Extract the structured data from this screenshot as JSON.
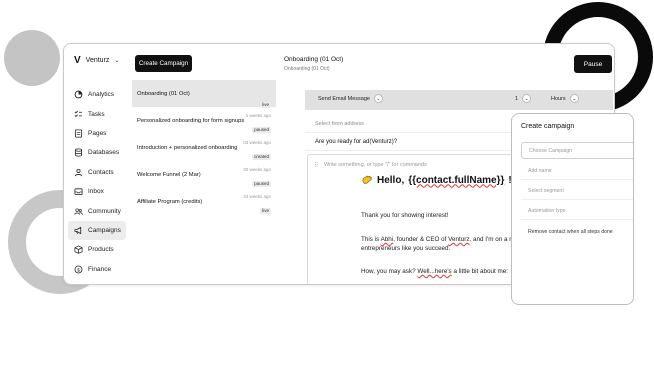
{
  "sidebar": {
    "brand": "Venturz",
    "items": [
      {
        "label": "Analytics",
        "icon": "analytics-icon"
      },
      {
        "label": "Tasks",
        "icon": "tasks-icon"
      },
      {
        "label": "Pages",
        "icon": "pages-icon"
      },
      {
        "label": "Databases",
        "icon": "database-icon"
      },
      {
        "label": "Contacts",
        "icon": "contacts-icon"
      },
      {
        "label": "Inbox",
        "icon": "inbox-icon"
      },
      {
        "label": "Community",
        "icon": "community-icon"
      },
      {
        "label": "Campaigns",
        "icon": "megaphone-icon"
      },
      {
        "label": "Products",
        "icon": "box-icon"
      },
      {
        "label": "Finance",
        "icon": "finance-icon"
      }
    ],
    "active_item": "Campaigns"
  },
  "toolbar": {
    "create_label": "Create Campaign",
    "pause_label": "Pause"
  },
  "campaigns": [
    {
      "name": "Onboarding (01 Oct)",
      "time": "",
      "status": "live"
    },
    {
      "name": "Personalized onboarding for form signups",
      "time": "1 weeks ago",
      "status": "paused"
    },
    {
      "name": "Introduction + personalized onboarding",
      "time": "03 weeks ago",
      "status": "created"
    },
    {
      "name": "Welcome Funnel (2 Mar)",
      "time": "30 weeks ago",
      "status": "paused"
    },
    {
      "name": "Affiliate Program (credits)",
      "time": "34 weeks ago",
      "status": "live"
    }
  ],
  "header": {
    "title": "Onboarding (01 Oct)",
    "subtitle": "Onboarding (01 Oct)"
  },
  "step": {
    "type": "Send Email Message",
    "delay_value": "1",
    "delay_unit": "Hours",
    "from_placeholder": "Select from address",
    "subject": "Are you ready for ad(Venturz)?"
  },
  "editor": {
    "placeholder": "Write something, or type \"/\" for commands",
    "greeting_prefix": "Hello, ",
    "greeting_var": "{{contact.fullName}}",
    "greeting_suffix": "!",
    "p1": "Thank you for showing interest!",
    "p2_a": "This is ",
    "p2_name": "Abhi",
    "p2_b": ", founder & CEO of ",
    "p2_brand": "Venturz",
    "p2_c": ", and I'm on a m",
    "p2_line2": "entrepreneurs like you succeed.",
    "p3_a": "How, you may ask? ",
    "p3_well": "Well...here's",
    "p3_b": " a little bit about me:"
  },
  "panel": {
    "title": "Create campaign",
    "fields": [
      "Choose Campaign",
      "Add name",
      "Select segment",
      "Automation type"
    ],
    "remove_label": "Remove contact when all steps done"
  },
  "colors": {
    "accent": "#111111",
    "active_bg": "#ececec",
    "toolbar_bg": "#e0e0e0",
    "deco_grey": "#c4c4c4",
    "deco_black": "#0a0a0a"
  }
}
